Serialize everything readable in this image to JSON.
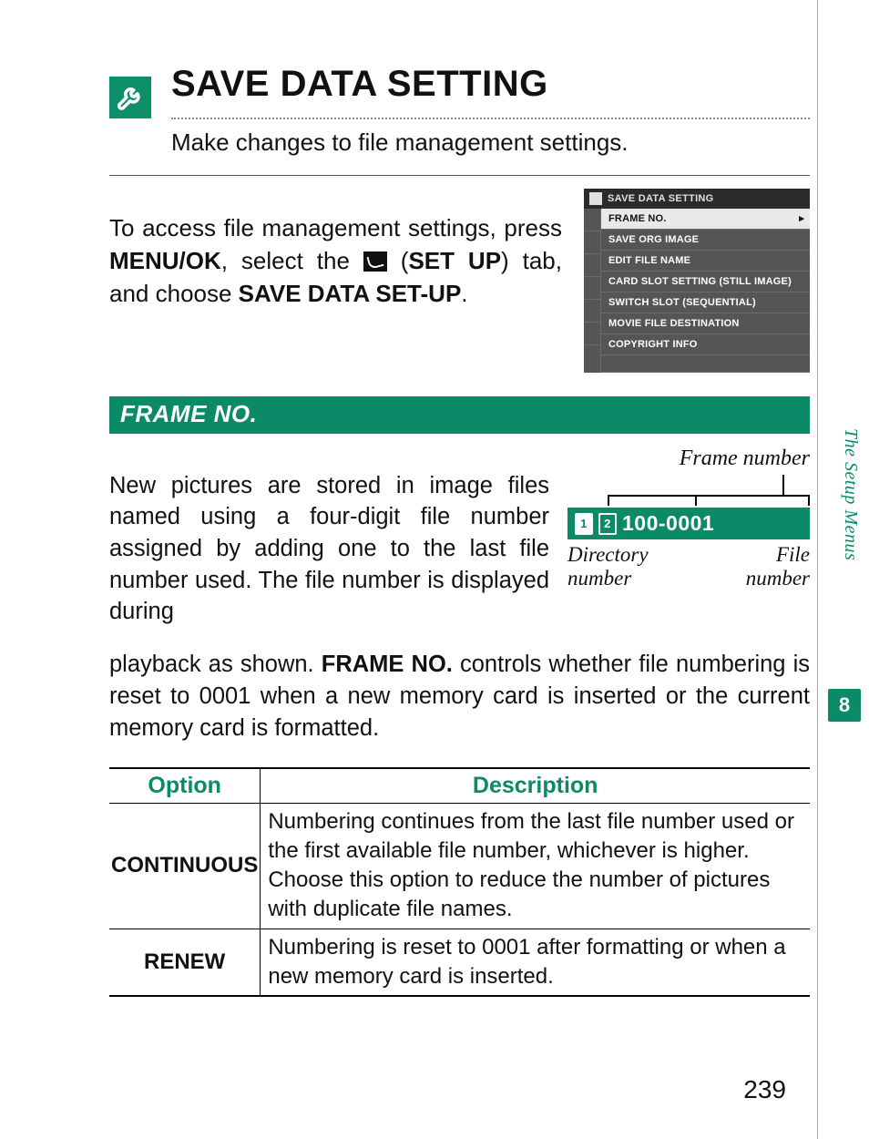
{
  "title": "SAVE DATA SETTING",
  "subtitle": "Make changes to file management settings.",
  "intro": {
    "seg1": "To access file management settings, press ",
    "kw_menuok": "MENU/OK",
    "seg2": ", select the ",
    "seg3": " (",
    "kw_setup": "SET UP",
    "seg4": ") tab, and choose ",
    "kw_save": "SAVE DATA SET-UP",
    "seg5": "."
  },
  "menu_screenshot": {
    "header": "SAVE DATA SETTING",
    "items": [
      {
        "label": "FRAME NO.",
        "selected": true
      },
      {
        "label": "SAVE ORG IMAGE",
        "selected": false
      },
      {
        "label": "EDIT FILE NAME",
        "selected": false
      },
      {
        "label": "CARD SLOT SETTING (STILL IMAGE)",
        "selected": false
      },
      {
        "label": "SWITCH SLOT (SEQUENTIAL)",
        "selected": false
      },
      {
        "label": "MOVIE FILE DESTINATION",
        "selected": false
      },
      {
        "label": "COPYRIGHT INFO",
        "selected": false
      }
    ]
  },
  "section_heading": "FRAME NO.",
  "frame_para_wrap": "New pictures are stored in image files named using a four-digit file number assigned by adding one to the last file number used. The file number is displayed during",
  "frame_para_rest_pre": "playback as shown. ",
  "frame_para_kw": "FRAME NO.",
  "frame_para_rest_post": " controls whether file numbering is reset to 0001 when a new memory card is inserted or the current memory card is formatted.",
  "figure": {
    "top_label": "Frame number",
    "slot1": "1",
    "slot2": "2",
    "value": "100-0001",
    "bottom_left_l1": "Directory",
    "bottom_left_l2": "number",
    "bottom_right_l1": "File",
    "bottom_right_l2": "number"
  },
  "table": {
    "headers": [
      "Option",
      "Description"
    ],
    "rows": [
      {
        "option": "CONTINUOUS",
        "desc": "Numbering continues from the last file number used or the first available file number, whichever is higher. Choose this option to reduce the number of pictures with duplicate file names."
      },
      {
        "option": "RENEW",
        "desc": "Numbering is reset to 0001 after formatting or when a new memory card is inserted."
      }
    ]
  },
  "sidebar_label": "The Setup Menus",
  "chapter_number": "8",
  "page_number": "239"
}
